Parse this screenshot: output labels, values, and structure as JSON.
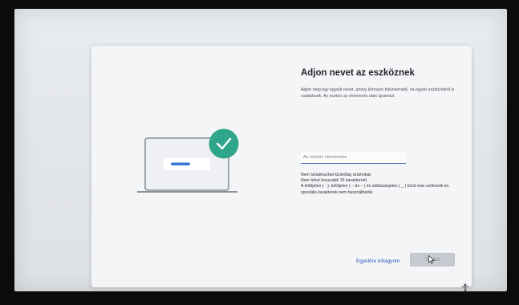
{
  "dialog": {
    "title": "Adjon nevet az eszköznek",
    "description": "Adjon meg egy egyedi nevet, amely könnyen felismerhető, ha egyéb eszközökről is csatlakozik. Az eszköz az elnevezés után újraindul.",
    "name_input": {
      "value": "",
      "placeholder": "Az eszköz elnevezése"
    },
    "rules": [
      "Nem tartalmazhat kizárólag számokat.",
      "Nem lehet hosszabb 15 karakternél.",
      "A kötőjelen ( - ), kötőjelen ( – és – ) és aláhúzásjelen ( _ ) kívül más szóközök és speciális karakterek nem használhatók."
    ],
    "skip_label": "Egyelőre kihagyom",
    "next_label": "Tovább"
  },
  "icons": {
    "illustration": "laptop-check-illustration",
    "accessibility": "accessibility-icon",
    "cursor": "mouse-cursor-icon"
  },
  "colors": {
    "accent_teal": "#2fa58c",
    "accent_blue": "#2a58b6"
  }
}
